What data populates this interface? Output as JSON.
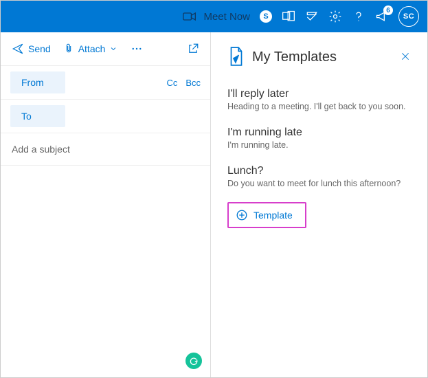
{
  "header": {
    "meet_now": "Meet Now",
    "skype_letter": "S",
    "notification_count": "6",
    "avatar_initials": "SC"
  },
  "toolbar": {
    "send": "Send",
    "attach": "Attach"
  },
  "compose": {
    "from_label": "From",
    "to_label": "To",
    "cc_label": "Cc",
    "bcc_label": "Bcc",
    "subject_placeholder": "Add a subject"
  },
  "panel": {
    "title": "My Templates",
    "templates": [
      {
        "title": "I'll reply later",
        "subtitle": "Heading to a meeting. I'll get back to you soon."
      },
      {
        "title": "I'm running late",
        "subtitle": "I'm running late."
      },
      {
        "title": "Lunch?",
        "subtitle": "Do you want to meet for lunch this afternoon?"
      }
    ],
    "add_label": "Template"
  }
}
